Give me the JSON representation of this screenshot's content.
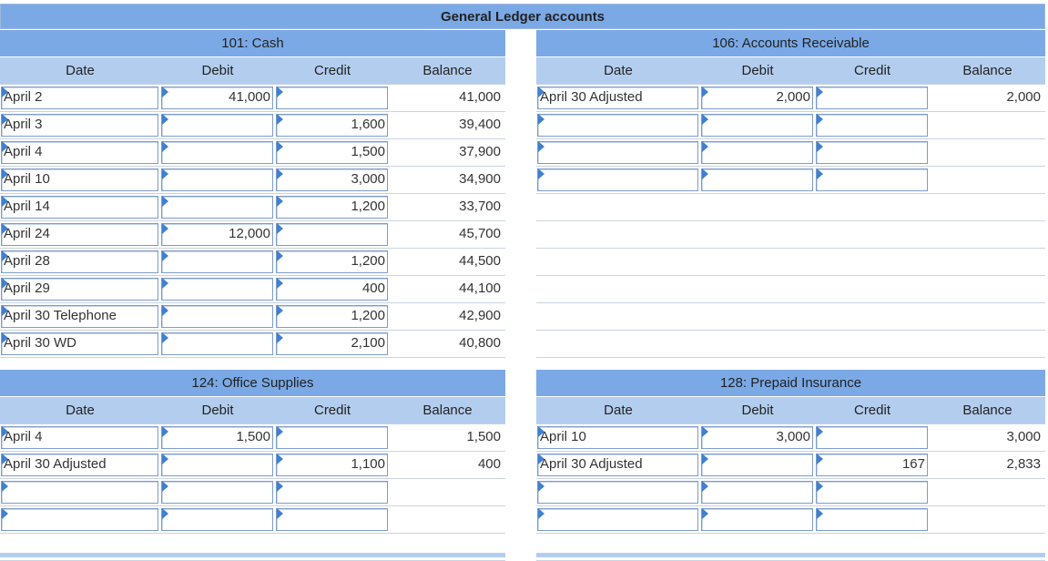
{
  "page_title": "General Ledger accounts",
  "columns": {
    "date": "Date",
    "debit": "Debit",
    "credit": "Credit",
    "balance": "Balance"
  },
  "accounts": [
    {
      "title": "101: Cash",
      "rows": [
        {
          "date": "April 2",
          "debit": "41,000",
          "credit": "",
          "balance": "41,000"
        },
        {
          "date": "April 3",
          "debit": "",
          "credit": "1,600",
          "balance": "39,400"
        },
        {
          "date": "April 4",
          "debit": "",
          "credit": "1,500",
          "balance": "37,900"
        },
        {
          "date": "April 10",
          "debit": "",
          "credit": "3,000",
          "balance": "34,900"
        },
        {
          "date": "April 14",
          "debit": "",
          "credit": "1,200",
          "balance": "33,700"
        },
        {
          "date": "April 24",
          "debit": "12,000",
          "credit": "",
          "balance": "45,700"
        },
        {
          "date": "April 28",
          "debit": "",
          "credit": "1,200",
          "balance": "44,500"
        },
        {
          "date": "April 29",
          "debit": "",
          "credit": "400",
          "balance": "44,100"
        },
        {
          "date": "April 30 Telephone",
          "debit": "",
          "credit": "1,200",
          "balance": "42,900"
        },
        {
          "date": "April 30 WD",
          "debit": "",
          "credit": "2,100",
          "balance": "40,800"
        }
      ]
    },
    {
      "title": "106: Accounts Receivable",
      "rows": [
        {
          "date": "April 30 Adjusted",
          "debit": "2,000",
          "credit": "",
          "balance": "2,000"
        },
        {
          "date": "",
          "debit": "",
          "credit": "",
          "balance": ""
        },
        {
          "date": "",
          "debit": "",
          "credit": "",
          "balance": ""
        },
        {
          "date": "",
          "debit": "",
          "credit": "",
          "balance": ""
        }
      ]
    },
    {
      "title": "124: Office Supplies",
      "rows": [
        {
          "date": "April 4",
          "debit": "1,500",
          "credit": "",
          "balance": "1,500"
        },
        {
          "date": "April 30 Adjusted",
          "debit": "",
          "credit": "1,100",
          "balance": "400"
        },
        {
          "date": "",
          "debit": "",
          "credit": "",
          "balance": ""
        },
        {
          "date": "",
          "debit": "",
          "credit": "",
          "balance": ""
        }
      ]
    },
    {
      "title": "128: Prepaid Insurance",
      "rows": [
        {
          "date": "April 10",
          "debit": "3,000",
          "credit": "",
          "balance": "3,000"
        },
        {
          "date": "April 30 Adjusted",
          "debit": "",
          "credit": "167",
          "balance": "2,833"
        },
        {
          "date": "",
          "debit": "",
          "credit": "",
          "balance": ""
        },
        {
          "date": "",
          "debit": "",
          "credit": "",
          "balance": ""
        }
      ]
    }
  ]
}
